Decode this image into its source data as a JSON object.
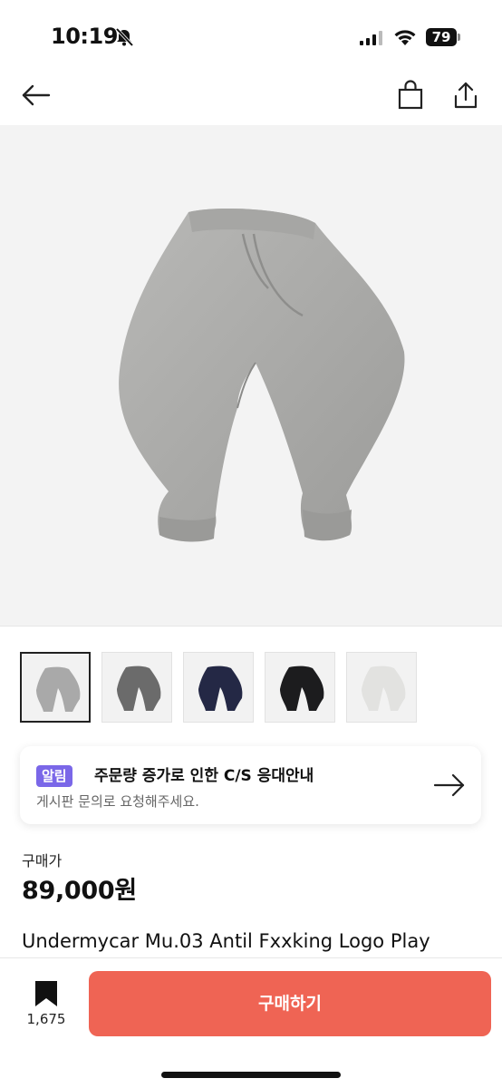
{
  "status_bar": {
    "time": "10:19",
    "battery": "79"
  },
  "nav": {
    "back_icon": "arrow-left-icon",
    "cart_icon": "shopping-bag-icon",
    "share_icon": "share-icon"
  },
  "gallery": {
    "thumbnails": [
      {
        "color": "#a9a9a9",
        "selected": true
      },
      {
        "color": "#6b6b6b",
        "selected": false
      },
      {
        "color": "#242845",
        "selected": false
      },
      {
        "color": "#1c1c1e",
        "selected": false
      },
      {
        "color": "#e2e2e0",
        "selected": false
      }
    ]
  },
  "notice": {
    "badge": "알림",
    "title": "주문량 증가로 인한 C/S 응대안내",
    "subtitle": "게시판 문의로 요청해주세요."
  },
  "price": {
    "label": "구매가",
    "value": "89,000원"
  },
  "product": {
    "name": "Undermycar Mu.03 Antil Fxxking Logo Play"
  },
  "bottom": {
    "bookmark_count": "1,675",
    "buy_label": "구매하기"
  },
  "colors": {
    "accent": "#ef6454",
    "badge": "#7a67e8"
  }
}
